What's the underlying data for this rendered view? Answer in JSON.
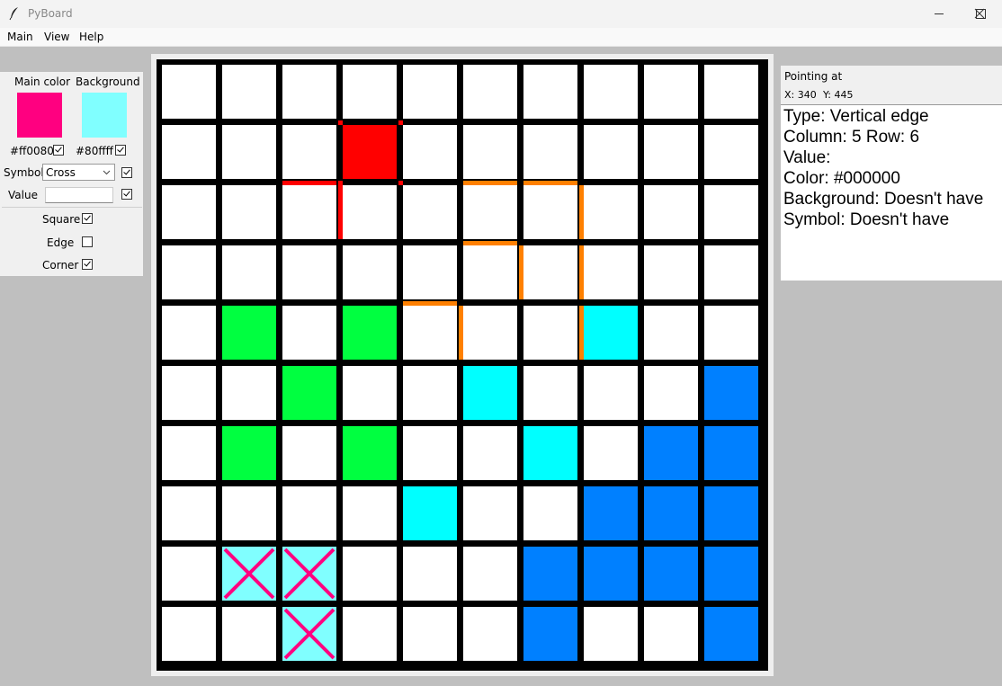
{
  "window": {
    "title": "PyBoard"
  },
  "menu": [
    "Main",
    "View",
    "Help"
  ],
  "icons": {
    "app": "feather-icon",
    "minimize": "minimize-icon",
    "maximize": "maximize-icon",
    "close": "close-icon",
    "dropdown": "chevron-down-icon"
  },
  "left_panel": {
    "main_color_label": "Main color",
    "background_label": "Background",
    "main_color": {
      "hex": "#ff0080",
      "text": "#ff0080",
      "checked": true
    },
    "background_color": {
      "hex": "#80ffff",
      "text": "#80ffff",
      "checked": true
    },
    "symbol_label": "Symbol",
    "symbol_value": "Cross",
    "symbol_checked": true,
    "value_label": "Value",
    "value_text": "",
    "value_checked": true,
    "square_label": "Square",
    "square_checked": true,
    "edge_label": "Edge",
    "edge_checked": false,
    "corner_label": "Corner",
    "corner_checked": true
  },
  "info": {
    "header": "Pointing at",
    "x_label": "X: 340",
    "y_label": "Y: 445",
    "type": "Type: Vertical edge",
    "position": "Column: 5  Row: 6",
    "value": "Value:",
    "color": "Color: #000000",
    "background": "Background: Doesn't have",
    "symbol": "Symbol: Doesn't have"
  },
  "board": {
    "columns": 10,
    "rows": 10,
    "colors": {
      "grid": "#000000",
      "empty": "#ffffff",
      "green": "#00ff40",
      "cyan": "#00ffff",
      "blue": "#0080ff",
      "red": "#ff0000",
      "orange": "#ff8000",
      "light_cyan": "#80ffff",
      "pink": "#ff0080"
    },
    "filled_cells": [
      {
        "row": 1,
        "col": 3,
        "color": "red"
      },
      {
        "row": 4,
        "col": 1,
        "color": "green"
      },
      {
        "row": 4,
        "col": 3,
        "color": "green"
      },
      {
        "row": 4,
        "col": 7,
        "color": "cyan"
      },
      {
        "row": 5,
        "col": 2,
        "color": "green"
      },
      {
        "row": 5,
        "col": 5,
        "color": "cyan"
      },
      {
        "row": 5,
        "col": 9,
        "color": "blue"
      },
      {
        "row": 6,
        "col": 1,
        "color": "green"
      },
      {
        "row": 6,
        "col": 3,
        "color": "green"
      },
      {
        "row": 6,
        "col": 6,
        "color": "cyan"
      },
      {
        "row": 6,
        "col": 8,
        "color": "blue"
      },
      {
        "row": 6,
        "col": 9,
        "color": "blue"
      },
      {
        "row": 7,
        "col": 4,
        "color": "cyan"
      },
      {
        "row": 7,
        "col": 7,
        "color": "blue"
      },
      {
        "row": 7,
        "col": 8,
        "color": "blue"
      },
      {
        "row": 7,
        "col": 9,
        "color": "blue"
      },
      {
        "row": 8,
        "col": 1,
        "color": "light_cyan",
        "symbol": "cross"
      },
      {
        "row": 8,
        "col": 2,
        "color": "light_cyan",
        "symbol": "cross"
      },
      {
        "row": 8,
        "col": 6,
        "color": "blue"
      },
      {
        "row": 8,
        "col": 7,
        "color": "blue"
      },
      {
        "row": 8,
        "col": 8,
        "color": "blue"
      },
      {
        "row": 8,
        "col": 9,
        "color": "blue"
      },
      {
        "row": 9,
        "col": 2,
        "color": "light_cyan",
        "symbol": "cross"
      },
      {
        "row": 9,
        "col": 6,
        "color": "blue"
      },
      {
        "row": 9,
        "col": 9,
        "color": "blue"
      }
    ],
    "colored_edges": [
      {
        "type": "h",
        "line": 2,
        "col": 2,
        "color": "red"
      },
      {
        "type": "v",
        "line": 3,
        "row": 2,
        "color": "red"
      },
      {
        "type": "h",
        "line": 2,
        "col": 5,
        "color": "orange"
      },
      {
        "type": "h",
        "line": 2,
        "col": 6,
        "color": "orange"
      },
      {
        "type": "v",
        "line": 7,
        "row": 2,
        "color": "orange"
      },
      {
        "type": "h",
        "line": 3,
        "col": 5,
        "color": "orange"
      },
      {
        "type": "v",
        "line": 6,
        "row": 3,
        "color": "orange"
      },
      {
        "type": "v",
        "line": 7,
        "row": 3,
        "color": "orange"
      },
      {
        "type": "h",
        "line": 4,
        "col": 4,
        "color": "orange"
      },
      {
        "type": "v",
        "line": 5,
        "row": 4,
        "color": "orange"
      },
      {
        "type": "v",
        "line": 7,
        "row": 4,
        "color": "orange"
      }
    ],
    "colored_corners": [
      {
        "x": 3,
        "y": 1,
        "color": "red"
      },
      {
        "x": 4,
        "y": 1,
        "color": "red"
      },
      {
        "x": 3,
        "y": 2,
        "color": "red"
      },
      {
        "x": 4,
        "y": 2,
        "color": "red"
      }
    ]
  }
}
